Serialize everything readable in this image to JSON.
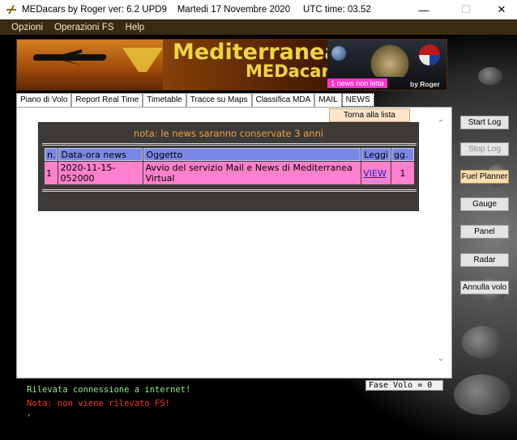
{
  "window": {
    "title": "MEDacars by Roger ver: 6.2 UPD9    Martedi 17 Novembre 2020     UTC time: 03.52",
    "icon": "app-icon"
  },
  "menu": {
    "items": [
      "Opzioni",
      "Operazioni FS",
      "Help"
    ]
  },
  "banner": {
    "title": "Mediterranea",
    "subtitle": "MEDacars",
    "news_badge": "1 news non letta",
    "credit": "by Roger"
  },
  "tabs": [
    "Piano di Volo",
    "Report Real Time",
    "Timetable",
    "Tracce su Maps",
    "Classifica MDA",
    "MAIL",
    "NEWS"
  ],
  "active_tab": "NEWS",
  "back_button": "Torna alla lista",
  "news": {
    "note": "nota: le news saranno conservate 3 anni",
    "headers": [
      "n.",
      "Data-ora news",
      "Oggetto",
      "Leggi",
      "gg."
    ],
    "rows": [
      {
        "n": "1",
        "datetime": "2020-11-15-052000",
        "subject": "Avvio del servizio Mail e News di Mediterranea Virtual",
        "action": "VIEW",
        "days": "1"
      }
    ]
  },
  "side_buttons": {
    "start_log": "Start Log",
    "stop_log": "Stop Log",
    "fuel_planner": "Fuel Planner",
    "gauge": "Gauge",
    "panel": "Panel",
    "radar": "Radar",
    "annulla_volo": "Annulla volo"
  },
  "status": {
    "fase_volo": "Fase Volo = 0",
    "line1": "Rilevata connessione a internet!",
    "line2": "Nota: non viene rilevato FS!"
  },
  "colors": {
    "menubar_bg": "#3a2a14",
    "table_header": "#7b88e6",
    "table_row": "#ff80cc",
    "note_text": "#f0a040",
    "ok_text": "#8cf080",
    "error_text": "#ff3030"
  }
}
